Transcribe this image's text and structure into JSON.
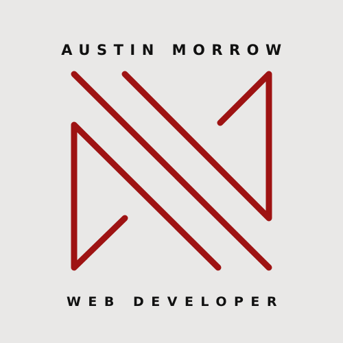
{
  "logo": {
    "name": "AUSTIN MORROW",
    "tagline": "WEB DEVELOPER",
    "accent_color": "#9e1313",
    "text_color": "#111111",
    "background_color": "#e9e8e7"
  }
}
